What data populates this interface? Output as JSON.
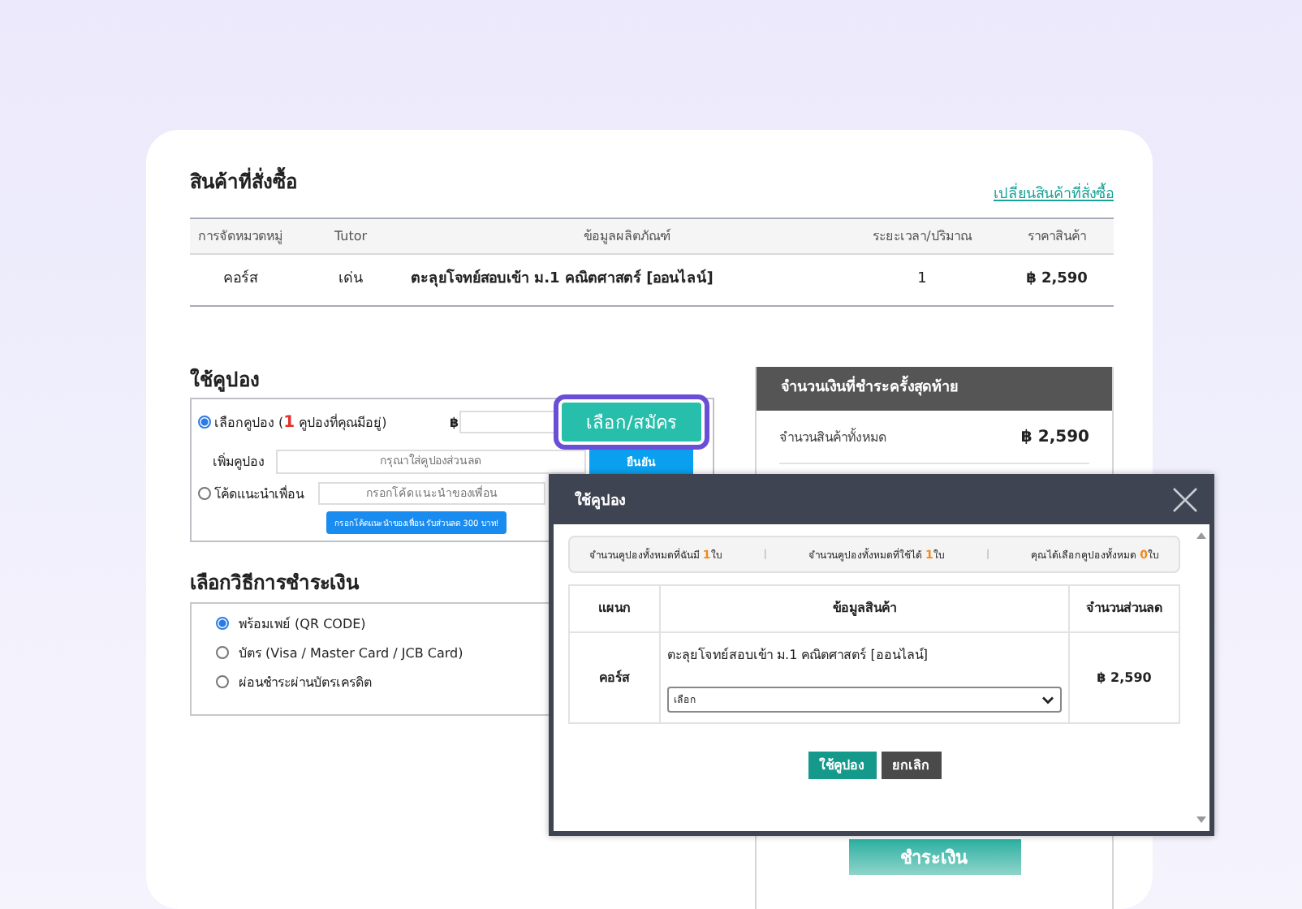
{
  "order": {
    "title": "สินค้าที่สั่งซื้อ",
    "change_link": "เปลี่ยนสินค้าที่สั่งซื้อ",
    "columns": [
      "การจัดหมวดหมู่",
      "Tutor",
      "ข้อมูลผลิตภัณฑ์",
      "ระยะเวลา/ปริมาณ",
      "ราคาสินค้า"
    ],
    "rows": [
      {
        "cells": [
          "คอร์ส",
          "เด่น",
          "ตะลุยโจทย์สอบเข้า ม.1 คณิตศาสตร์ [ออนไลน์]",
          "1",
          "฿ 2,590"
        ]
      }
    ]
  },
  "coupon": {
    "title": "ใช้คูปอง",
    "select_option": {
      "selected": true,
      "label_prefix": "เลือกคูปอง (",
      "count": "1",
      "label_suffix": " คูปองที่คุณมีอยู่)"
    },
    "currency": "฿",
    "choose_button": {
      "label": "เลือก/สมัคร",
      "highlighted": true
    },
    "add": {
      "label": "เพิ่มคูปอง",
      "placeholder": "กรุณาใส่คูปองส่วนลด",
      "button": "ยืนยัน"
    },
    "referral": {
      "selected": false,
      "label": "โค้ดแนะนำเพื่อน",
      "placeholder": "กรอกโค้ดแนะนำของเพื่อน",
      "hint": "กรอกโค้ดแนะนำของเพื่อน รับส่วนลด 300 บาท!"
    }
  },
  "payment": {
    "title": "เลือกวิธีการชำระเงิน",
    "methods": [
      {
        "label": "พร้อมเพย์ (QR CODE)",
        "selected": true
      },
      {
        "label": "บัตร (Visa / Master Card / JCB Card)",
        "selected": false
      },
      {
        "label": "ผ่อนชำระผ่านบัตรเครดิต",
        "selected": false
      }
    ]
  },
  "summary": {
    "title": "จำนวนเงินที่ชำระครั้งสุดท้าย",
    "rows": [
      {
        "label": "จำนวนสินค้าทั้งหมด",
        "value": "฿ 2,590"
      }
    ],
    "pay_button": "ชำระเงิน"
  },
  "dialog": {
    "title": "ใช้คูปอง",
    "stats": [
      {
        "label": "จำนวนคูปองทั้งหมดที่ฉันมี",
        "count": "1",
        "unit": "ใบ"
      },
      {
        "label": "จำนวนคูปองทั้งหมดที่ใช้ได้",
        "count": "1",
        "unit": "ใบ"
      },
      {
        "label": "คุณได้เลือกคูปองทั้งหมด",
        "count": "0",
        "unit": "ใบ"
      }
    ],
    "stat_separator": "|",
    "columns": [
      "แผนก",
      "ข้อมูลสินค้า",
      "จำนวนส่วนลด"
    ],
    "rows": [
      {
        "department": "คอร์ส",
        "product": "ตะลุยโจทย์สอบเข้า ม.1 คณิตศาสตร์ [ออนไลน์]",
        "select_value": "เลือก",
        "discount": "฿ 2,590"
      }
    ],
    "buttons": [
      {
        "label": "ใช้คูปอง",
        "kind": "primary"
      },
      {
        "label": "ยกเลิก",
        "kind": "secondary"
      }
    ]
  }
}
